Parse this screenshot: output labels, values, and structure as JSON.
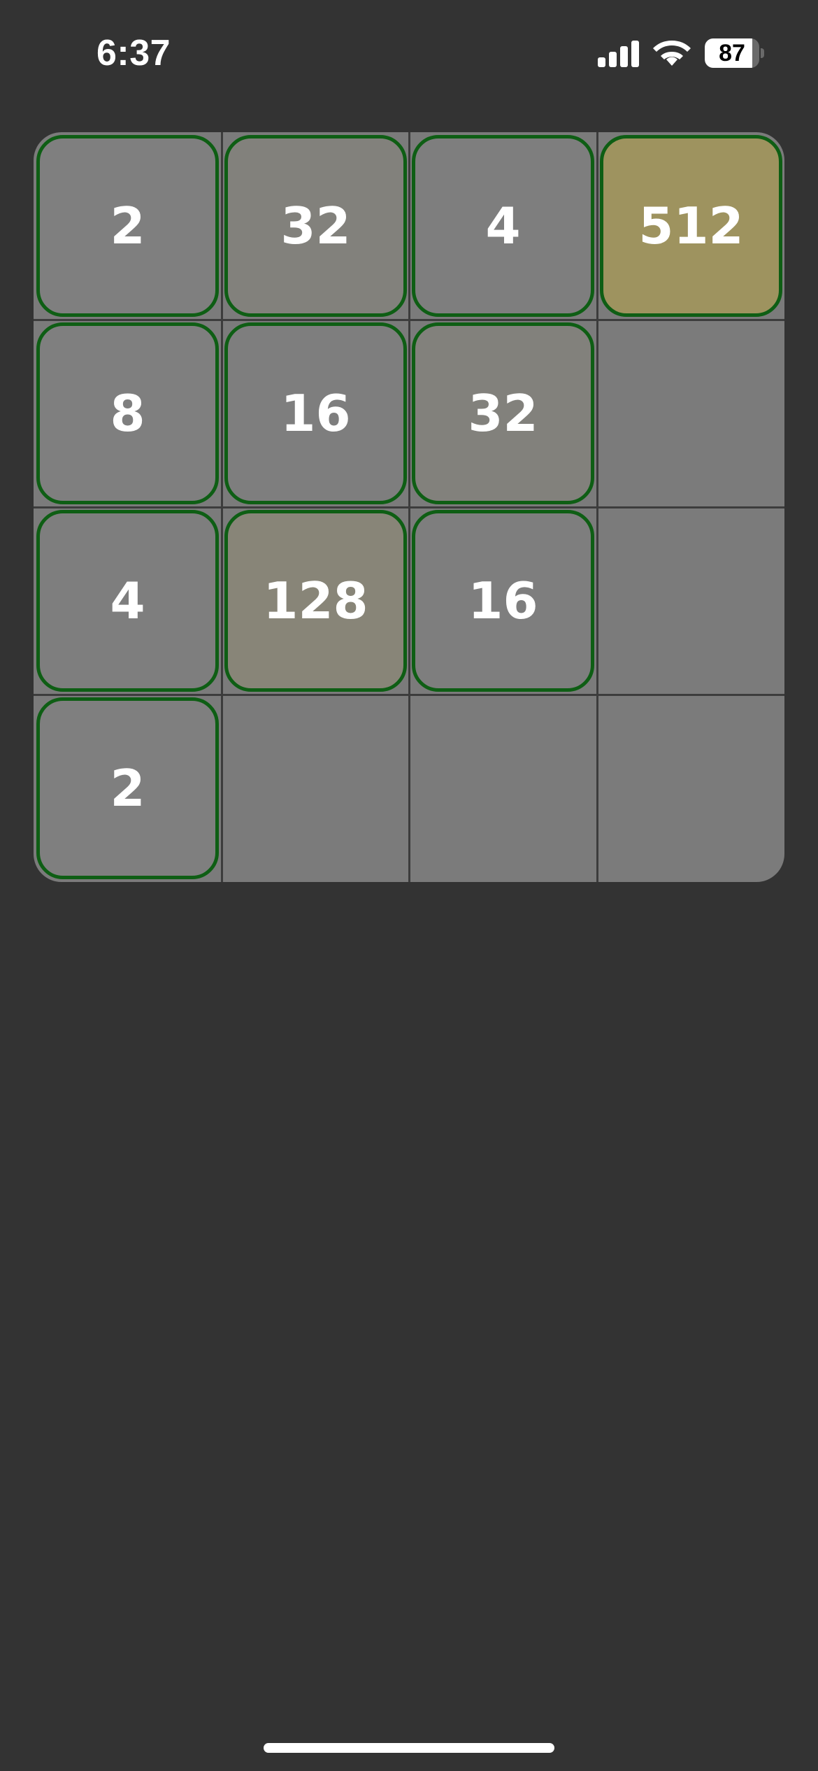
{
  "status_bar": {
    "time": "6:37",
    "battery_level": "87",
    "battery_fraction": 0.87,
    "signal_bars_active": 3,
    "signal_bars_total": 4
  },
  "board": {
    "size": 4,
    "rows": [
      [
        "2",
        "32",
        "4",
        "512"
      ],
      [
        "8",
        "16",
        "32",
        ""
      ],
      [
        "4",
        "128",
        "16",
        ""
      ],
      [
        "2",
        "",
        "",
        ""
      ]
    ]
  },
  "colors": {
    "background": "#333333",
    "board": "#7b7b7b",
    "grid_line": "#3c3c3c",
    "tile_border": "#0e5e14",
    "tile_text": "#ffffff",
    "tile_fills": {
      "2": "#7f7f7f",
      "4": "#7e7e7e",
      "8": "#7f7f7f",
      "16": "#7e7e7e",
      "32": "#82817c",
      "128": "#888578",
      "512": "#9e935f"
    }
  }
}
